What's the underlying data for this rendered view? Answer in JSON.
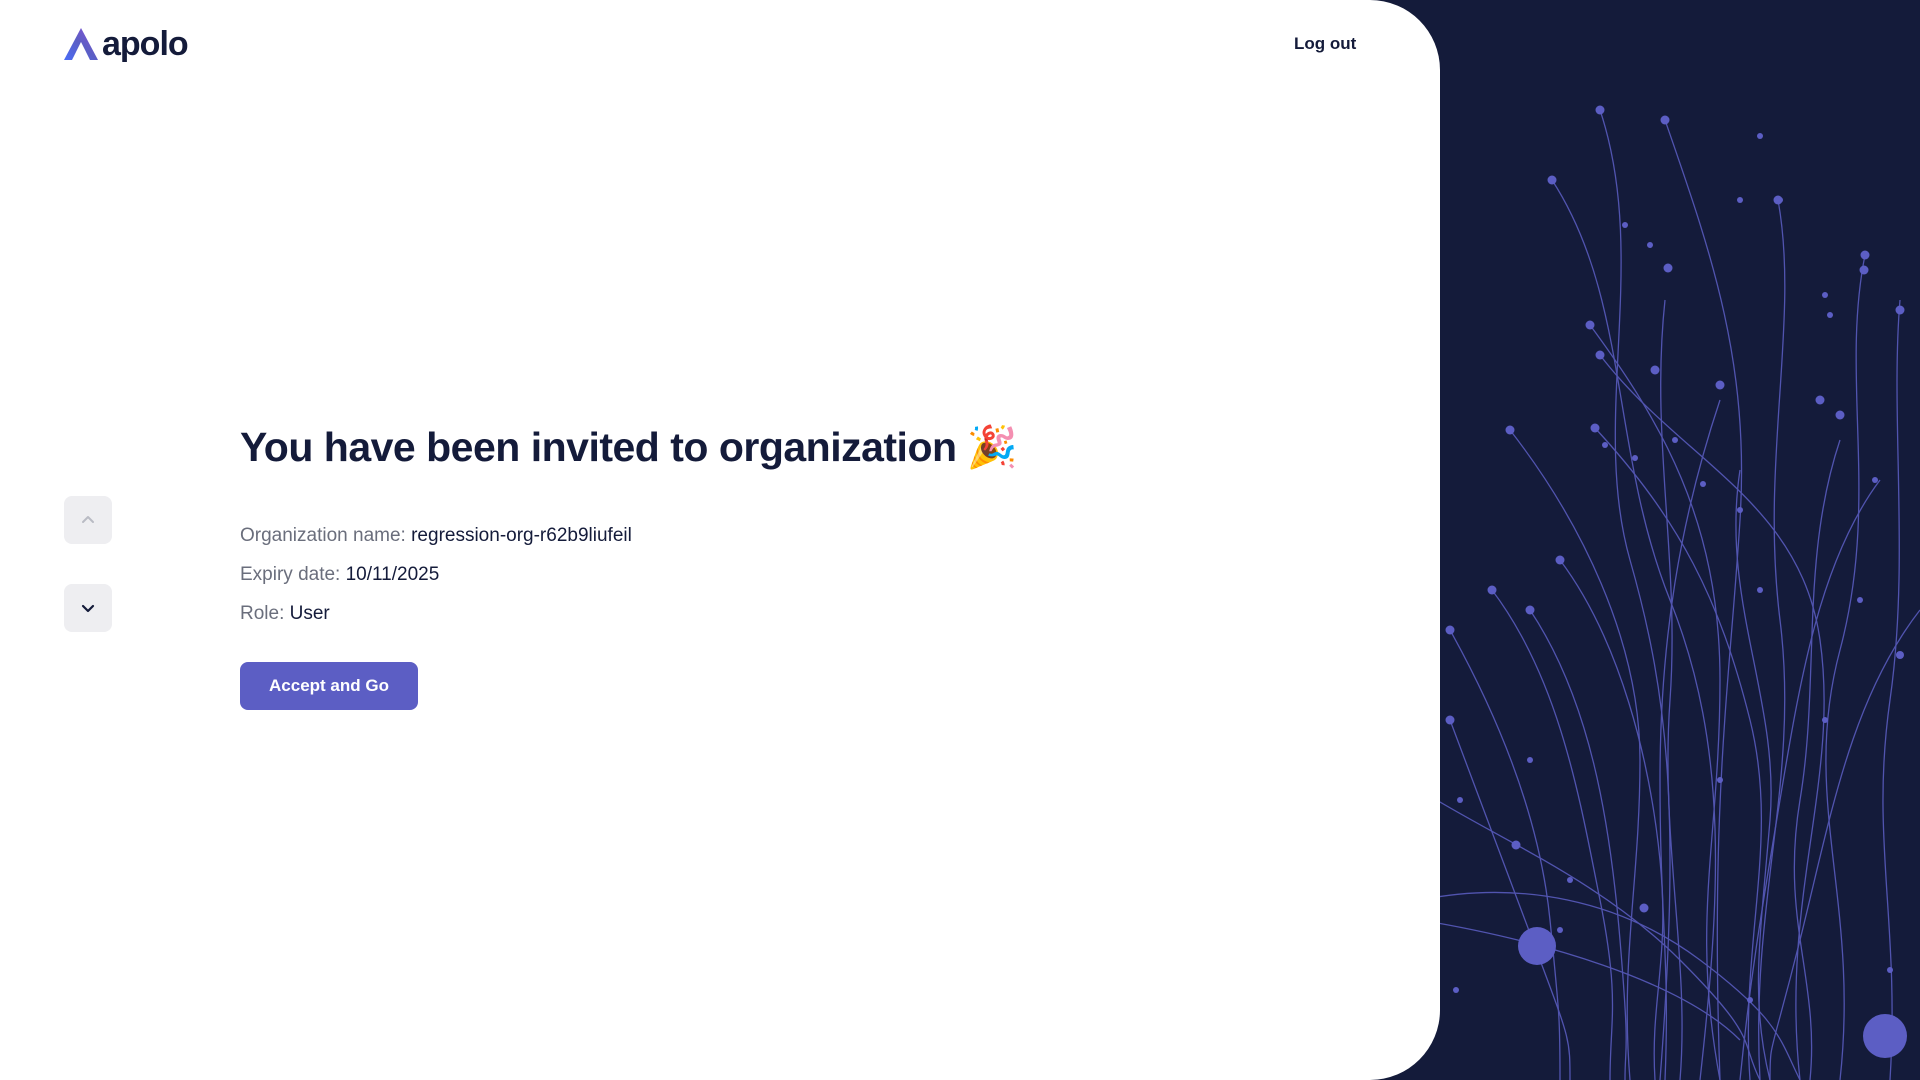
{
  "brand": {
    "name": "apolo",
    "accent": "#5c5ec4",
    "dark": "#141b3a"
  },
  "header": {
    "logout_label": "Log out"
  },
  "nav": {
    "up_icon": "chevron-up-icon",
    "down_icon": "chevron-down-icon"
  },
  "invite": {
    "title": "You have been invited to organization",
    "title_emoji": "🎉",
    "org_label": "Organization name:",
    "org_value": "regression-org-r62b9liufeil",
    "expiry_label": "Expiry date:",
    "expiry_value": "10/11/2025",
    "role_label": "Role:",
    "role_value": "User",
    "accept_label": "Accept and Go"
  }
}
